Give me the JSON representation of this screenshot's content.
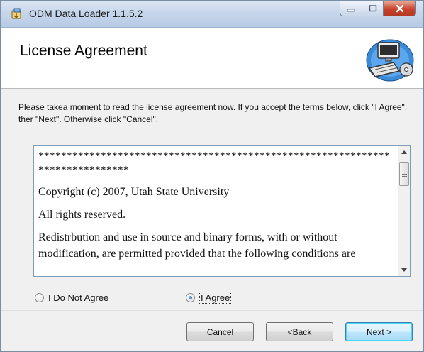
{
  "window": {
    "title": "ODM Data Loader 1.1.5.2",
    "icon": "installer-app-icon"
  },
  "header": {
    "title": "License Agreement",
    "graphic": "computer-setup-graphic"
  },
  "instructions": "Please takea moment to read the license agreement now. If you accept the terms below, click \"I Agree\", ther \"Next\". Otherwise click \"Cancel\".",
  "license": {
    "stars_line1": "**************************************************************",
    "stars_line2": "****************",
    "copyright": "Copyright (c) 2007, Utah State University",
    "rights": "All rights reserved.",
    "redistribution": "Redistrbution and use in source and binary forms, with or without modification, are permitted provided that the following conditions are"
  },
  "options": {
    "do_not_agree": {
      "prefix": "I ",
      "accel": "D",
      "rest": "o Not Agree",
      "selected": false
    },
    "agree": {
      "prefix": "I ",
      "accel": "A",
      "rest": "gree",
      "selected": true
    }
  },
  "buttons": {
    "cancel": "Cancel",
    "back_prefix": "< ",
    "back_accel": "B",
    "back_rest": "ack",
    "next": "Next >"
  },
  "colors": {
    "accent": "#3c7fb1",
    "close": "#c9412a"
  }
}
